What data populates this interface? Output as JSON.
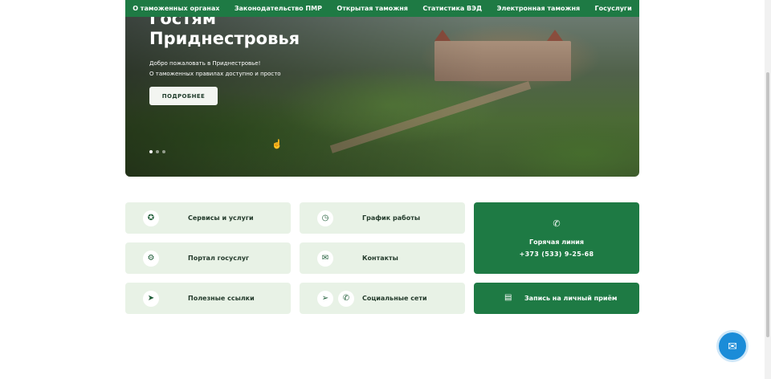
{
  "topnav": {
    "items": [
      "О таможенных органах",
      "Законодательство ПМР",
      "Открытая таможня",
      "Статистика ВЭД",
      "Электронная таможня",
      "Госуслуги"
    ]
  },
  "hero": {
    "title_line1": "Гостям",
    "title_line2": "Приднестровья",
    "subtitle_line1": "Добро пожаловать в Приднестровье!",
    "subtitle_line2": "О таможенных правилах доступно и просто",
    "button_label": "ПОДРОБНЕЕ",
    "slides_count": 3,
    "active_slide": 1
  },
  "tiles": {
    "services": {
      "label": "Сервисы и услуги",
      "icon": "star-icon"
    },
    "gosuslugi": {
      "label": "Портал госуслуг",
      "icon": "gear-icon"
    },
    "links": {
      "label": "Полезные ссылки",
      "icon": "cursor-icon"
    },
    "schedule": {
      "label": "График работы",
      "icon": "clock-icon"
    },
    "contacts": {
      "label": "Контакты",
      "icon": "mail-icon"
    },
    "social": {
      "label": "Социальные сети",
      "icons": [
        "telegram-icon",
        "viber-icon"
      ]
    }
  },
  "hotline": {
    "title": "Горячая линия",
    "phone": "+373 (533) 9-25-68",
    "icon": "phone-icon"
  },
  "appointment": {
    "label": "Запись на личный приём",
    "icon": "calendar-icon"
  },
  "chat": {
    "icon": "chat-bubble-icon"
  },
  "colors": {
    "brand_green": "#1e7a44",
    "tile_bg": "#e8f2e6",
    "chat_blue": "#1b8cd8"
  }
}
